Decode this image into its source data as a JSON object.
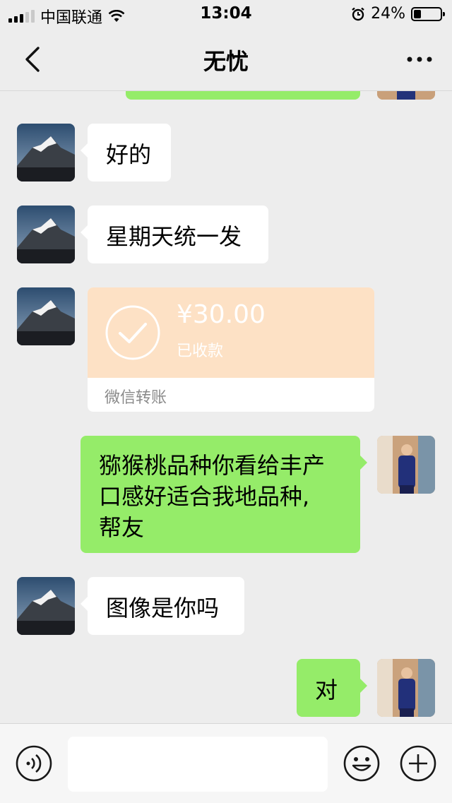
{
  "status_bar": {
    "carrier": "中国联通",
    "time": "13:04",
    "battery": "24%"
  },
  "nav": {
    "title": "无忧"
  },
  "messages": [
    {
      "from": "other",
      "text": "好的"
    },
    {
      "from": "other",
      "text": "星期天统一发"
    },
    {
      "from": "other",
      "type": "transfer",
      "amount": "¥30.00",
      "status": "已收款",
      "footer": "微信转账"
    },
    {
      "from": "me",
      "lines": [
        "猕猴桃品种你看给丰产",
        "口感好适合我地品种,",
        "帮友"
      ]
    },
    {
      "from": "other",
      "text": "图像是你吗"
    },
    {
      "from": "me",
      "text": "对"
    }
  ],
  "colors": {
    "background": "#ededed",
    "bubble_me": "#95ec69",
    "bubble_other": "#ffffff",
    "transfer": "#fde1c5"
  },
  "icons": [
    "back-icon",
    "more-icon",
    "voice-icon",
    "emoji-icon",
    "plus-icon",
    "check-circle-icon",
    "wifi-icon",
    "alarm-icon"
  ]
}
